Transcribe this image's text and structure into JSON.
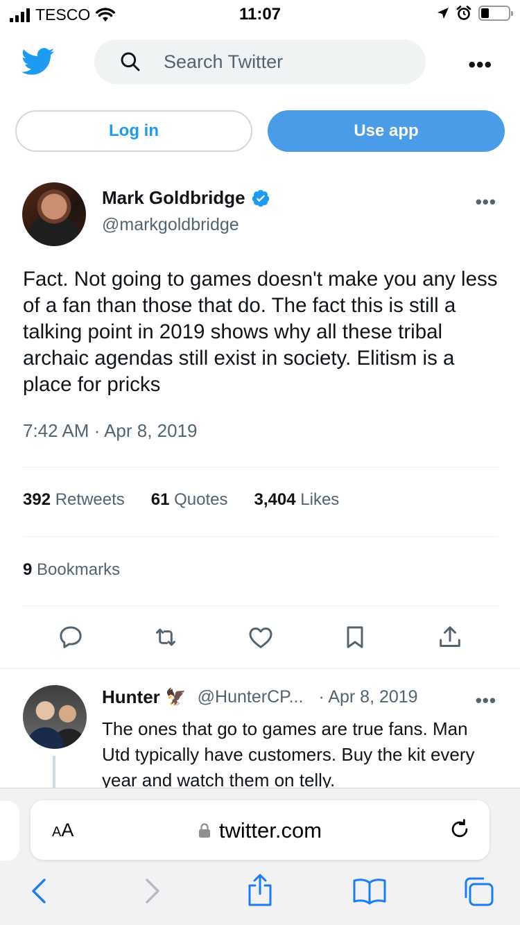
{
  "status_bar": {
    "carrier": "TESCO",
    "time": "11:07"
  },
  "header": {
    "logo_icon": "twitter-bird-icon",
    "search_placeholder": "Search Twitter",
    "more_label": "•••"
  },
  "auth": {
    "login_label": "Log in",
    "use_app_label": "Use app"
  },
  "tweet": {
    "author_name": "Mark Goldbridge",
    "verified": true,
    "author_handle": "@markgoldbridge",
    "more_label": "•••",
    "text": "Fact. Not going to games doesn't make you any less of a fan than those that do. The fact this is still a talking point in 2019 shows why all these tribal archaic agendas still exist in society. Elitism is a place for pricks",
    "timestamp": "7:42 AM · Apr 8, 2019",
    "stats": {
      "retweets_count": "392",
      "retweets_label": "Retweets",
      "quotes_count": "61",
      "quotes_label": "Quotes",
      "likes_count": "3,404",
      "likes_label": "Likes",
      "bookmarks_count": "9",
      "bookmarks_label": "Bookmarks"
    },
    "actions": [
      "reply-icon",
      "retweet-icon",
      "like-icon",
      "bookmark-icon",
      "share-icon"
    ]
  },
  "reply": {
    "author_name": "Hunter",
    "emoji": "🦅",
    "author_handle": "@HunterCP...",
    "date": "· Apr 8, 2019",
    "more_label": "•••",
    "text": "The ones that go to games are true fans. Man Utd typically have customers. Buy the kit every year and watch them on telly."
  },
  "safari": {
    "text_size_label_small": "A",
    "text_size_label_big": "A",
    "url": "twitter.com",
    "toolbar": [
      "back-icon",
      "forward-icon",
      "share-icon",
      "bookmarks-icon",
      "tabs-icon"
    ]
  },
  "colors": {
    "twitter_blue": "#1d9bf0",
    "text_primary": "#0f1419",
    "text_secondary": "#536471",
    "safari_blue": "#1b7cf5"
  }
}
